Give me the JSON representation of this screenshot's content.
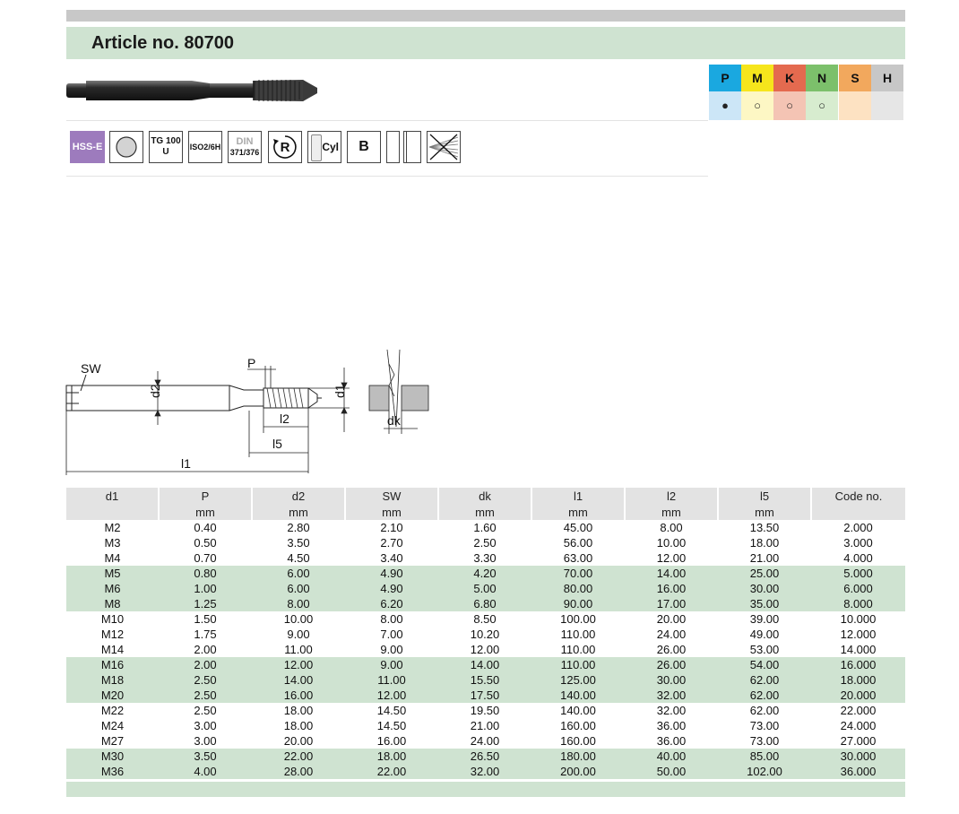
{
  "title": "Article no.  80700",
  "materials": [
    {
      "letter": "P",
      "color": "#1aa8e0",
      "symbol": "●",
      "bg": "#cce6f7"
    },
    {
      "letter": "M",
      "color": "#f6e51c",
      "symbol": "○",
      "bg": "#fdf7c4"
    },
    {
      "letter": "K",
      "color": "#e46a4f",
      "symbol": "○",
      "bg": "#f4c4b4"
    },
    {
      "letter": "N",
      "color": "#7cc06b",
      "symbol": "○",
      "bg": "#d7eccf"
    },
    {
      "letter": "S",
      "color": "#f2a85d",
      "symbol": "",
      "bg": "#fde2c2"
    },
    {
      "letter": "H",
      "color": "#c7c7c7",
      "symbol": "",
      "bg": "#e6e6e6"
    }
  ],
  "icons": {
    "hsse": "HSS-E",
    "tg_line1": "TG 100",
    "tg_line2": "U",
    "iso": "ISO2/6H",
    "din_line1": "DIN",
    "din_line2": "371/376",
    "r": "R",
    "cyl": "Cyl",
    "b": "B"
  },
  "diagram_labels": {
    "sw": "SW",
    "p": "P",
    "d2": "d2",
    "d1": "d1",
    "l2": "l2",
    "l5": "l5",
    "l1": "l1",
    "dk": "dk"
  },
  "table": {
    "columns": [
      {
        "name": "d1",
        "unit": ""
      },
      {
        "name": "P",
        "unit": "mm"
      },
      {
        "name": "d2",
        "unit": "mm"
      },
      {
        "name": "SW",
        "unit": "mm"
      },
      {
        "name": "dk",
        "unit": "mm"
      },
      {
        "name": "l1",
        "unit": "mm"
      },
      {
        "name": "l2",
        "unit": "mm"
      },
      {
        "name": "l5",
        "unit": "mm"
      },
      {
        "name": "Code no.",
        "unit": ""
      }
    ],
    "rows": [
      [
        "M2",
        "0.40",
        "2.80",
        "2.10",
        "1.60",
        "45.00",
        "8.00",
        "13.50",
        "2.000"
      ],
      [
        "M3",
        "0.50",
        "3.50",
        "2.70",
        "2.50",
        "56.00",
        "10.00",
        "18.00",
        "3.000"
      ],
      [
        "M4",
        "0.70",
        "4.50",
        "3.40",
        "3.30",
        "63.00",
        "12.00",
        "21.00",
        "4.000"
      ],
      [
        "M5",
        "0.80",
        "6.00",
        "4.90",
        "4.20",
        "70.00",
        "14.00",
        "25.00",
        "5.000"
      ],
      [
        "M6",
        "1.00",
        "6.00",
        "4.90",
        "5.00",
        "80.00",
        "16.00",
        "30.00",
        "6.000"
      ],
      [
        "M8",
        "1.25",
        "8.00",
        "6.20",
        "6.80",
        "90.00",
        "17.00",
        "35.00",
        "8.000"
      ],
      [
        "M10",
        "1.50",
        "10.00",
        "8.00",
        "8.50",
        "100.00",
        "20.00",
        "39.00",
        "10.000"
      ],
      [
        "M12",
        "1.75",
        "9.00",
        "7.00",
        "10.20",
        "110.00",
        "24.00",
        "49.00",
        "12.000"
      ],
      [
        "M14",
        "2.00",
        "11.00",
        "9.00",
        "12.00",
        "110.00",
        "26.00",
        "53.00",
        "14.000"
      ],
      [
        "M16",
        "2.00",
        "12.00",
        "9.00",
        "14.00",
        "110.00",
        "26.00",
        "54.00",
        "16.000"
      ],
      [
        "M18",
        "2.50",
        "14.00",
        "11.00",
        "15.50",
        "125.00",
        "30.00",
        "62.00",
        "18.000"
      ],
      [
        "M20",
        "2.50",
        "16.00",
        "12.00",
        "17.50",
        "140.00",
        "32.00",
        "62.00",
        "20.000"
      ],
      [
        "M22",
        "2.50",
        "18.00",
        "14.50",
        "19.50",
        "140.00",
        "32.00",
        "62.00",
        "22.000"
      ],
      [
        "M24",
        "3.00",
        "18.00",
        "14.50",
        "21.00",
        "160.00",
        "36.00",
        "73.00",
        "24.000"
      ],
      [
        "M27",
        "3.00",
        "20.00",
        "16.00",
        "24.00",
        "160.00",
        "36.00",
        "73.00",
        "27.000"
      ],
      [
        "M30",
        "3.50",
        "22.00",
        "18.00",
        "26.50",
        "180.00",
        "40.00",
        "85.00",
        "30.000"
      ],
      [
        "M36",
        "4.00",
        "28.00",
        "22.00",
        "32.00",
        "200.00",
        "50.00",
        "102.00",
        "36.000"
      ]
    ]
  }
}
